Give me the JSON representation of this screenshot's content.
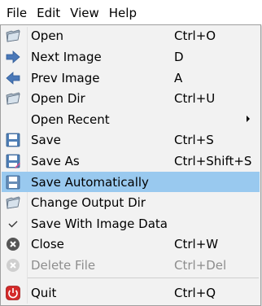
{
  "menubar": {
    "items": [
      {
        "label": "File"
      },
      {
        "label": "Edit"
      },
      {
        "label": "View"
      },
      {
        "label": "Help"
      }
    ]
  },
  "file_menu": {
    "items": [
      {
        "label": "Open",
        "shortcut": "Ctrl+O",
        "icon": "open-folder-icon"
      },
      {
        "label": "Next Image",
        "shortcut": "D",
        "icon": "arrow-right-icon"
      },
      {
        "label": "Prev Image",
        "shortcut": "A",
        "icon": "arrow-left-icon"
      },
      {
        "label": "Open Dir",
        "shortcut": "Ctrl+U",
        "icon": "open-folder-icon"
      },
      {
        "label": "Open Recent",
        "shortcut": "",
        "icon": "",
        "submenu": true
      },
      {
        "label": "Save",
        "shortcut": "Ctrl+S",
        "icon": "floppy-disk-icon"
      },
      {
        "label": "Save As",
        "shortcut": "Ctrl+Shift+S",
        "icon": "save-as-icon"
      },
      {
        "label": "Save Automatically",
        "shortcut": "",
        "icon": "floppy-disk-icon",
        "highlighted": true
      },
      {
        "label": "Change Output Dir",
        "shortcut": "",
        "icon": "open-folder-icon"
      },
      {
        "label": "Save With Image Data",
        "shortcut": "",
        "icon": "checkmark-icon"
      },
      {
        "label": "Close",
        "shortcut": "Ctrl+W",
        "icon": "close-circle-icon"
      },
      {
        "label": "Delete File",
        "shortcut": "Ctrl+Del",
        "icon": "delete-circle-icon",
        "disabled": true
      },
      {
        "label": "Quit",
        "shortcut": "Ctrl+Q",
        "icon": "power-icon"
      }
    ]
  },
  "colors": {
    "menu_background": "#f2f2f2",
    "highlight": "#99c9ef",
    "disabled_text": "#8d8d8d",
    "border": "#a0a0a0"
  }
}
